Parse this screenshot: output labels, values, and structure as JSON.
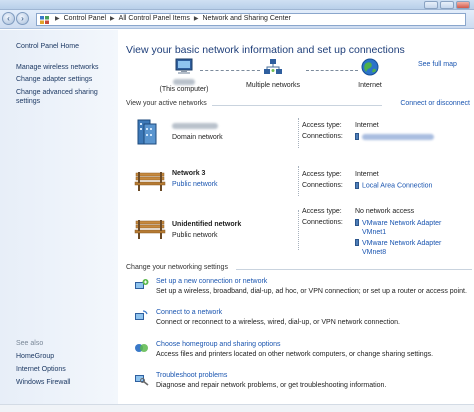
{
  "window": {
    "title": "Network and Sharing Center"
  },
  "address": {
    "crumbs": [
      "Control Panel",
      "All Control Panel Items",
      "Network and Sharing Center"
    ]
  },
  "sidebar": {
    "home": "Control Panel Home",
    "items": [
      "Manage wireless networks",
      "Change adapter settings",
      "Change advanced sharing settings"
    ],
    "see_also_label": "See also",
    "see_also": [
      "HomeGroup",
      "Internet Options",
      "Windows Firewall"
    ]
  },
  "main": {
    "title": "View your basic network information and set up connections",
    "see_full_map": "See full map",
    "map": {
      "computer_label": "(This computer)",
      "middle_label": "Multiple networks",
      "internet_label": "Internet"
    },
    "active_header": "View your active networks",
    "connect_disconnect": "Connect or disconnect",
    "networks": [
      {
        "name": "",
        "category": "Domain network",
        "access_key": "Access type:",
        "access_val": "Internet",
        "conn_key": "Connections:",
        "connections": [
          ""
        ]
      },
      {
        "name": "Network  3",
        "category": "Public network",
        "access_key": "Access type:",
        "access_val": "Internet",
        "conn_key": "Connections:",
        "connections": [
          "Local Area Connection"
        ]
      },
      {
        "name": "Unidentified network",
        "category": "Public network",
        "access_key": "Access type:",
        "access_val": "No network access",
        "conn_key": "Connections:",
        "connections": [
          "VMware Network Adapter VMnet1",
          "VMware Network Adapter VMnet8"
        ]
      }
    ],
    "change_header": "Change your networking settings",
    "tasks": [
      {
        "link": "Set up a new connection or network",
        "desc": "Set up a wireless, broadband, dial-up, ad hoc, or VPN connection; or set up a router or access point."
      },
      {
        "link": "Connect to a network",
        "desc": "Connect or reconnect to a wireless, wired, dial-up, or VPN network connection."
      },
      {
        "link": "Choose homegroup and sharing options",
        "desc": "Access files and printers located on other network computers, or change sharing settings."
      },
      {
        "link": "Troubleshoot problems",
        "desc": "Diagnose and repair network problems, or get troubleshooting information."
      }
    ]
  }
}
